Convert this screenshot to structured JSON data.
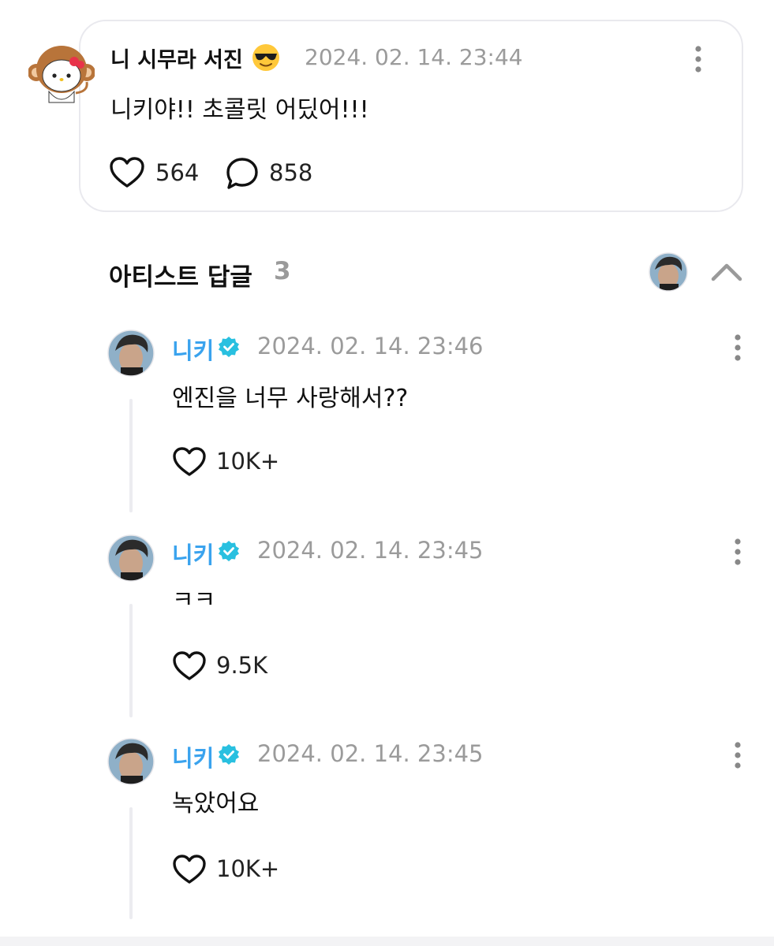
{
  "post": {
    "author": "니 시무라 서진",
    "author_emoji": "smiling-face-with-sunglasses",
    "timestamp": "2024. 02. 14. 23:44",
    "text": "니키야!! 초콜릿 어딨어!!!",
    "like_count": "564",
    "comment_count": "858"
  },
  "replies_section": {
    "title": "아티스트 답글",
    "count": "3"
  },
  "replies": [
    {
      "author": "니키",
      "verified": true,
      "timestamp": "2024. 02. 14. 23:46",
      "text": "엔진을 너무 사랑해서??",
      "likes": "10K+"
    },
    {
      "author": "니키",
      "verified": true,
      "timestamp": "2024. 02. 14. 23:45",
      "text": "ㅋㅋ",
      "likes": "9.5K"
    },
    {
      "author": "니키",
      "verified": true,
      "timestamp": "2024. 02. 14. 23:45",
      "text": "녹았어요",
      "likes": "10K+"
    }
  ],
  "colors": {
    "artist_name": "#3aa3ee",
    "verified_badge": "#29c0e0",
    "muted_text": "#9b9b9b",
    "card_border": "#e9e9ee"
  },
  "icons": {
    "fan_avatar": "monkey-kitty-avatar",
    "artist_avatar": "artist-portrait-avatar",
    "like": "heart-outline-icon",
    "comment": "speech-bubble-icon",
    "more": "vertical-ellipsis-icon",
    "collapse": "chevron-up-icon",
    "verified": "verified-badge-icon"
  }
}
